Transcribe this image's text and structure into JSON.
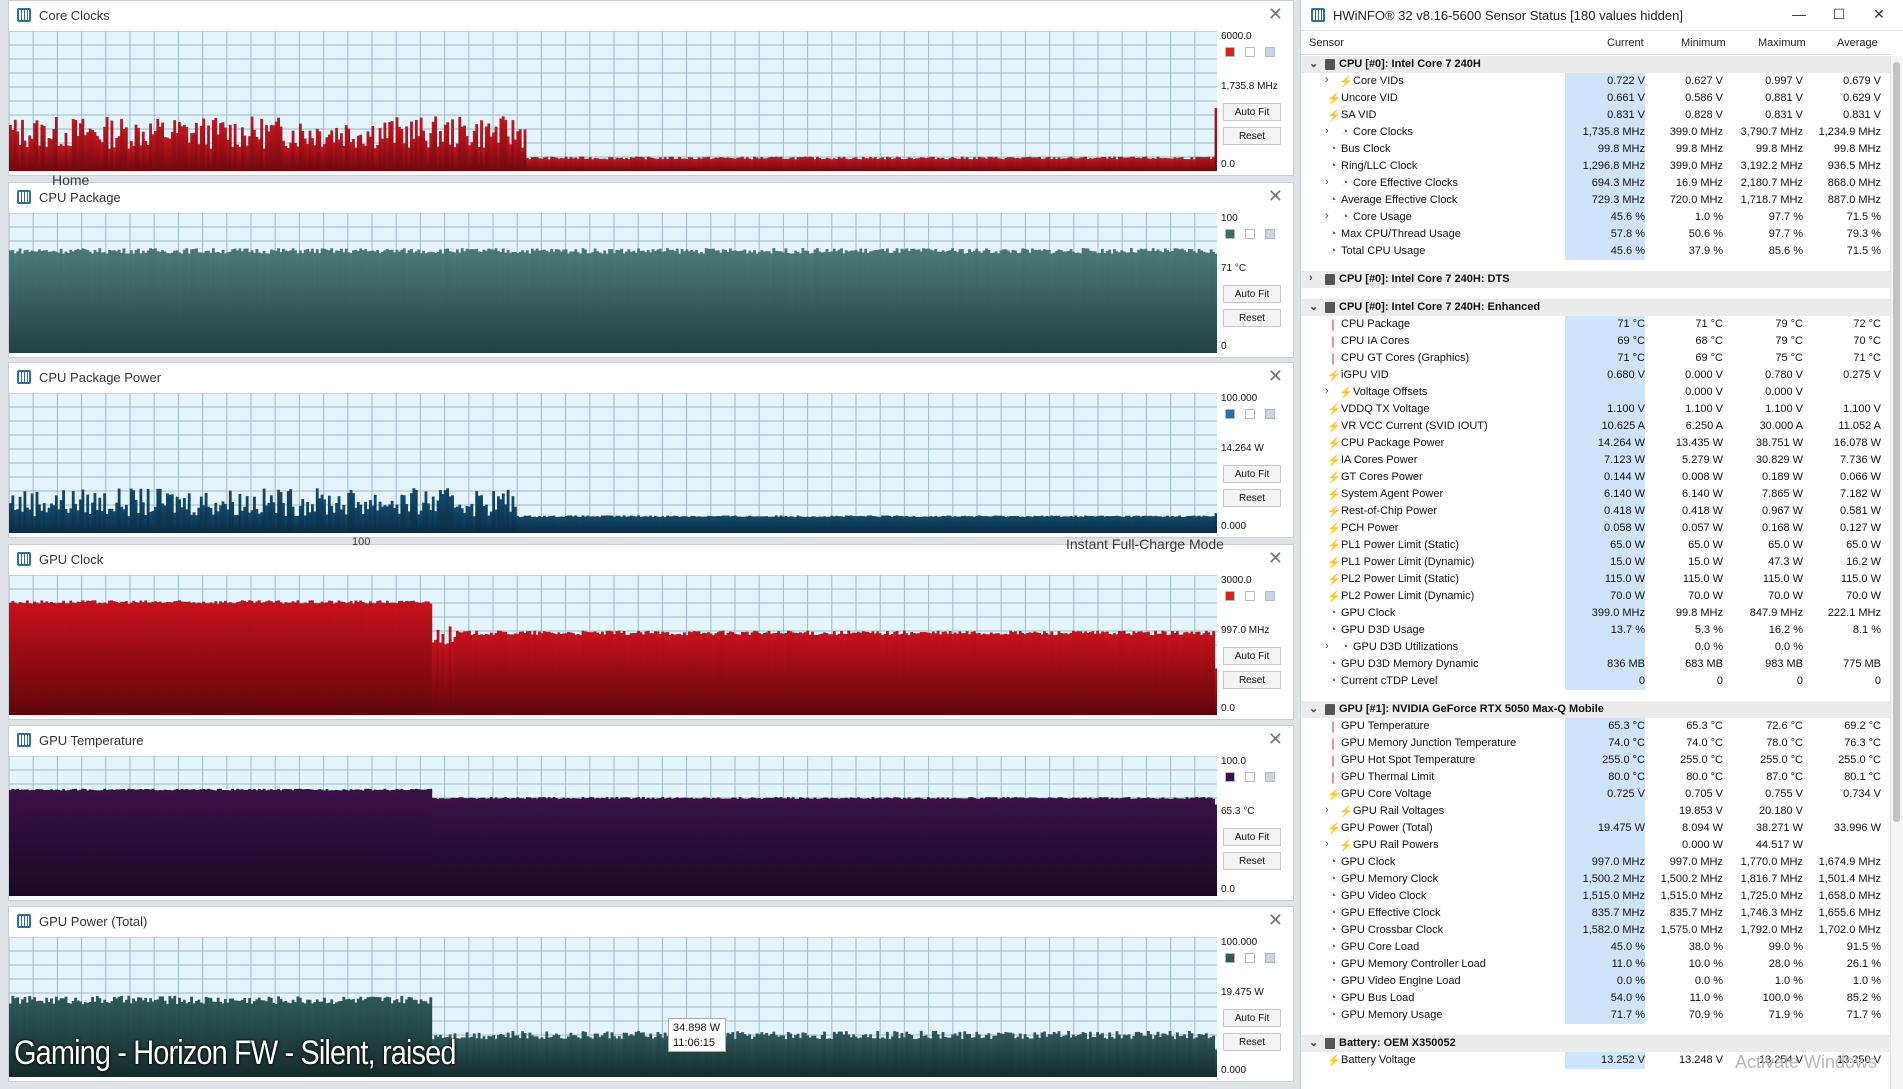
{
  "graphs": [
    {
      "id": "core-clocks",
      "title": "Core Clocks",
      "max": "6000.0",
      "cur": "1,735.8 MHz",
      "min": "0.0",
      "color": "#c3161c",
      "dark": "#6c0a10",
      "sq": [
        "#e01d1d",
        "#ffffff",
        "#c9d6ea"
      ],
      "chart_data": {
        "type": "bar",
        "ylim": [
          0,
          6000
        ],
        "phases": [
          {
            "n": 214,
            "base": 1650,
            "amp": 700
          },
          {
            "n": 286,
            "base": 560,
            "amp": 60
          }
        ],
        "spike_end": 2700
      }
    },
    {
      "id": "cpu-package",
      "title": "CPU Package",
      "max": "100",
      "cur": "71 °C",
      "min": "0",
      "color": "#4a7a76",
      "dark": "#23413f",
      "sq": [
        "#3a6b66",
        "#ffffff",
        "#c9d6ea"
      ],
      "chart_data": {
        "type": "bar",
        "ylim": [
          0,
          100
        ],
        "phases": [
          {
            "n": 500,
            "base": 73,
            "amp": 2
          }
        ],
        "spike_end": 71
      }
    },
    {
      "id": "cpu-package-power",
      "title": "CPU Package Power",
      "max": "100.000",
      "cur": "14.264 W",
      "min": "0.000",
      "color": "#124a6d",
      "dark": "#0a2c42",
      "sq": [
        "#1f6fb8",
        "#ffffff",
        "#c9d6ea"
      ],
      "chart_data": {
        "type": "bar",
        "ylim": [
          0,
          100
        ],
        "phases": [
          {
            "n": 210,
            "base": 22,
            "amp": 10
          },
          {
            "n": 290,
            "base": 12,
            "amp": 0.6
          }
        ],
        "spike_end": 14.2
      }
    },
    {
      "id": "gpu-clock",
      "title": "GPU Clock",
      "max": "3000.0",
      "cur": "997.0 MHz",
      "min": "0.0",
      "color": "#c8111a",
      "dark": "#5e070c",
      "sq": [
        "#e01d1d",
        "#ffffff",
        "#c9d6ea"
      ],
      "chart_data": {
        "type": "bar",
        "ylim": [
          0,
          3000
        ],
        "phases": [
          {
            "n": 175,
            "base": 2420,
            "amp": 40
          },
          {
            "n": 10,
            "base": 1700,
            "amp": 200
          },
          {
            "n": 315,
            "base": 1760,
            "amp": 50
          }
        ],
        "spike_end": 997
      }
    },
    {
      "id": "gpu-temperature",
      "title": "GPU Temperature",
      "max": "100.0",
      "cur": "65.3 °C",
      "min": "0.0",
      "color": "#3a1149",
      "dark": "#1a0822",
      "sq": [
        "#3a1149",
        "#ffffff",
        "#c9d6ea"
      ],
      "chart_data": {
        "type": "bar",
        "ylim": [
          0,
          100
        ],
        "phases": [
          {
            "n": 175,
            "base": 76,
            "amp": 0.6
          },
          {
            "n": 325,
            "base": 70,
            "amp": 0.7
          }
        ],
        "spike_end": 65.3
      }
    },
    {
      "id": "gpu-power-total",
      "title": "GPU Power (Total)",
      "max": "100.000",
      "cur": "19.475 W",
      "min": "0.000",
      "color": "#2d5a58",
      "dark": "#142b2a",
      "sq": [
        "#2d5a58",
        "#ffffff",
        "#c9d6ea"
      ],
      "chart_data": {
        "type": "bar",
        "ylim": [
          0,
          100
        ],
        "phases": [
          {
            "n": 175,
            "base": 55,
            "amp": 3
          },
          {
            "n": 325,
            "base": 30,
            "amp": 3
          }
        ],
        "spike_end": 19.5
      }
    }
  ],
  "buttons": {
    "autofit": "Auto Fit",
    "reset": "Reset"
  },
  "overlay": "Gaming - Horizon FW - Silent, raised",
  "tooltip": {
    "value": "34.898 W",
    "time": "11:06:15"
  },
  "ghosts": {
    "home": "Home",
    "hundred": "100",
    "instant": "Instant Full-Charge Mode"
  },
  "hwinfo": {
    "title": "HWiNFO® 32 v8.16-5600 Sensor Status [180 values hidden]",
    "columns": {
      "sensor": "Sensor",
      "current": "Current",
      "minimum": "Minimum",
      "maximum": "Maximum",
      "average": "Average"
    },
    "watermark": "Activate Windows",
    "rows": [
      {
        "t": "sec",
        "name": "CPU [#0]: Intel Core 7 240H",
        "open": true
      },
      {
        "name": "Core VIDs",
        "i": "v",
        "sub": true,
        "c": "0.722 V",
        "mn": "0.627 V",
        "mx": "0.997 V",
        "av": "0.679 V"
      },
      {
        "name": "Uncore VID",
        "i": "v",
        "c": "0.661 V",
        "mn": "0.586 V",
        "mx": "0.881 V",
        "av": "0.629 V"
      },
      {
        "name": "SA VID",
        "i": "v",
        "c": "0.831 V",
        "mn": "0.828 V",
        "mx": "0.831 V",
        "av": "0.831 V"
      },
      {
        "name": "Core Clocks",
        "i": "c",
        "sub": true,
        "c": "1,735.8 MHz",
        "mn": "399.0 MHz",
        "mx": "3,790.7 MHz",
        "av": "1,234.9 MHz"
      },
      {
        "name": "Bus Clock",
        "i": "c",
        "c": "99.8 MHz",
        "mn": "99.8 MHz",
        "mx": "99.8 MHz",
        "av": "99.8 MHz"
      },
      {
        "name": "Ring/LLC Clock",
        "i": "c",
        "c": "1,296.8 MHz",
        "mn": "399.0 MHz",
        "mx": "3,192.2 MHz",
        "av": "936.5 MHz"
      },
      {
        "name": "Core Effective Clocks",
        "i": "c",
        "sub": true,
        "c": "694.3 MHz",
        "mn": "16.9 MHz",
        "mx": "2,180.7 MHz",
        "av": "868.0 MHz"
      },
      {
        "name": "Average Effective Clock",
        "i": "c",
        "c": "729.3 MHz",
        "mn": "720.0 MHz",
        "mx": "1,718.7 MHz",
        "av": "887.0 MHz"
      },
      {
        "name": "Core Usage",
        "i": "c",
        "sub": true,
        "c": "45.6 %",
        "mn": "1.0 %",
        "mx": "97.7 %",
        "av": "71.5 %"
      },
      {
        "name": "Max CPU/Thread Usage",
        "i": "c",
        "c": "57.8 %",
        "mn": "50.6 %",
        "mx": "97.7 %",
        "av": "79.3 %"
      },
      {
        "name": "Total CPU Usage",
        "i": "c",
        "c": "45.6 %",
        "mn": "37.9 %",
        "mx": "85.6 %",
        "av": "71.5 %"
      },
      {
        "t": "gap"
      },
      {
        "t": "sec",
        "name": "CPU [#0]: Intel Core 7 240H: DTS",
        "open": false
      },
      {
        "t": "gap"
      },
      {
        "t": "sec",
        "name": "CPU [#0]: Intel Core 7 240H: Enhanced",
        "open": true
      },
      {
        "name": "CPU Package",
        "i": "t",
        "c": "71 °C",
        "mn": "71 °C",
        "mx": "79 °C",
        "av": "72 °C"
      },
      {
        "name": "CPU IA Cores",
        "i": "t",
        "c": "69 °C",
        "mn": "68 °C",
        "mx": "79 °C",
        "av": "70 °C"
      },
      {
        "name": "CPU GT Cores (Graphics)",
        "i": "t",
        "c": "71 °C",
        "mn": "69 °C",
        "mx": "75 °C",
        "av": "71 °C"
      },
      {
        "name": "iGPU VID",
        "i": "v",
        "c": "0.680 V",
        "mn": "0.000 V",
        "mx": "0.780 V",
        "av": "0.275 V"
      },
      {
        "name": "Voltage Offsets",
        "i": "v",
        "sub": true,
        "c": "",
        "mn": "0.000 V",
        "mx": "0.000 V",
        "av": ""
      },
      {
        "name": "VDDQ TX Voltage",
        "i": "v",
        "c": "1.100 V",
        "mn": "1.100 V",
        "mx": "1.100 V",
        "av": "1.100 V"
      },
      {
        "name": "VR VCC Current (SVID IOUT)",
        "i": "v",
        "c": "10.625 A",
        "mn": "6.250 A",
        "mx": "30.000 A",
        "av": "11.052 A"
      },
      {
        "name": "CPU Package Power",
        "i": "v",
        "c": "14.264 W",
        "mn": "13.435 W",
        "mx": "38.751 W",
        "av": "16.078 W"
      },
      {
        "name": "IA Cores Power",
        "i": "v",
        "c": "7.123 W",
        "mn": "5.279 W",
        "mx": "30.829 W",
        "av": "7.736 W"
      },
      {
        "name": "GT Cores Power",
        "i": "v",
        "c": "0.144 W",
        "mn": "0.008 W",
        "mx": "0.189 W",
        "av": "0.066 W"
      },
      {
        "name": "System Agent Power",
        "i": "v",
        "c": "6.140 W",
        "mn": "6.140 W",
        "mx": "7.865 W",
        "av": "7.182 W"
      },
      {
        "name": "Rest-of-Chip Power",
        "i": "v",
        "c": "0.418 W",
        "mn": "0.418 W",
        "mx": "0.967 W",
        "av": "0.581 W"
      },
      {
        "name": "PCH Power",
        "i": "v",
        "c": "0.058 W",
        "mn": "0.057 W",
        "mx": "0.168 W",
        "av": "0.127 W"
      },
      {
        "name": "PL1 Power Limit (Static)",
        "i": "v",
        "c": "65.0 W",
        "mn": "65.0 W",
        "mx": "65.0 W",
        "av": "65.0 W"
      },
      {
        "name": "PL1 Power Limit (Dynamic)",
        "i": "v",
        "c": "15.0 W",
        "mn": "15.0 W",
        "mx": "47.3 W",
        "av": "16.2 W"
      },
      {
        "name": "PL2 Power Limit (Static)",
        "i": "v",
        "c": "115.0 W",
        "mn": "115.0 W",
        "mx": "115.0 W",
        "av": "115.0 W"
      },
      {
        "name": "PL2 Power Limit (Dynamic)",
        "i": "v",
        "c": "70.0 W",
        "mn": "70.0 W",
        "mx": "70.0 W",
        "av": "70.0 W"
      },
      {
        "name": "GPU Clock",
        "i": "c",
        "c": "399.0 MHz",
        "mn": "99.8 MHz",
        "mx": "847.9 MHz",
        "av": "222.1 MHz"
      },
      {
        "name": "GPU D3D Usage",
        "i": "c",
        "c": "13.7 %",
        "mn": "5.3 %",
        "mx": "16.2 %",
        "av": "8.1 %"
      },
      {
        "name": "GPU D3D Utilizations",
        "i": "c",
        "sub": true,
        "c": "",
        "mn": "0.0 %",
        "mx": "0.0 %",
        "av": ""
      },
      {
        "name": "GPU D3D Memory Dynamic",
        "i": "c",
        "c": "836 MB",
        "mn": "683 MB",
        "mx": "983 MB",
        "av": "775 MB"
      },
      {
        "name": "Current cTDP Level",
        "i": "c",
        "c": "0",
        "mn": "0",
        "mx": "0",
        "av": "0"
      },
      {
        "t": "gap"
      },
      {
        "t": "sec",
        "name": "GPU [#1]: NVIDIA  GeForce RTX 5050 Max-Q Mobile",
        "open": true
      },
      {
        "name": "GPU Temperature",
        "i": "t",
        "c": "65.3 °C",
        "mn": "65.3 °C",
        "mx": "72.6 °C",
        "av": "69.2 °C"
      },
      {
        "name": "GPU Memory Junction Temperature",
        "i": "t",
        "c": "74.0 °C",
        "mn": "74.0 °C",
        "mx": "78.0 °C",
        "av": "76.3 °C"
      },
      {
        "name": "GPU Hot Spot Temperature",
        "i": "t",
        "c": "255.0 °C",
        "mn": "255.0 °C",
        "mx": "255.0 °C",
        "av": "255.0 °C"
      },
      {
        "name": "GPU Thermal Limit",
        "i": "t",
        "c": "80.0 °C",
        "mn": "80.0 °C",
        "mx": "87.0 °C",
        "av": "80.1 °C"
      },
      {
        "name": "GPU Core Voltage",
        "i": "v",
        "c": "0.725 V",
        "mn": "0.705 V",
        "mx": "0.755 V",
        "av": "0.734 V"
      },
      {
        "name": "GPU Rail Voltages",
        "i": "v",
        "sub": true,
        "c": "",
        "mn": "19.853 V",
        "mx": "20.180 V",
        "av": ""
      },
      {
        "name": "GPU Power (Total)",
        "i": "v",
        "c": "19.475 W",
        "mn": "8.094 W",
        "mx": "38.271 W",
        "av": "33.996 W"
      },
      {
        "name": "GPU Rail Powers",
        "i": "v",
        "sub": true,
        "c": "",
        "mn": "0.000 W",
        "mx": "44.517 W",
        "av": ""
      },
      {
        "name": "GPU Clock",
        "i": "c",
        "c": "997.0 MHz",
        "mn": "997.0 MHz",
        "mx": "1,770.0 MHz",
        "av": "1,674.9 MHz"
      },
      {
        "name": "GPU Memory Clock",
        "i": "c",
        "c": "1,500.2 MHz",
        "mn": "1,500.2 MHz",
        "mx": "1,816.7 MHz",
        "av": "1,501.4 MHz"
      },
      {
        "name": "GPU Video Clock",
        "i": "c",
        "c": "1,515.0 MHz",
        "mn": "1,515.0 MHz",
        "mx": "1,725.0 MHz",
        "av": "1,658.0 MHz"
      },
      {
        "name": "GPU Effective Clock",
        "i": "c",
        "c": "835.7 MHz",
        "mn": "835.7 MHz",
        "mx": "1,746.3 MHz",
        "av": "1,655.6 MHz"
      },
      {
        "name": "GPU Crossbar Clock",
        "i": "c",
        "c": "1,582.0 MHz",
        "mn": "1,575.0 MHz",
        "mx": "1,792.0 MHz",
        "av": "1,702.0 MHz"
      },
      {
        "name": "GPU Core Load",
        "i": "c",
        "c": "45.0 %",
        "mn": "38.0 %",
        "mx": "99.0 %",
        "av": "91.5 %"
      },
      {
        "name": "GPU Memory Controller Load",
        "i": "c",
        "c": "11.0 %",
        "mn": "10.0 %",
        "mx": "28.0 %",
        "av": "26.1 %"
      },
      {
        "name": "GPU Video Engine Load",
        "i": "c",
        "c": "0.0 %",
        "mn": "0.0 %",
        "mx": "1.0 %",
        "av": "1.0 %"
      },
      {
        "name": "GPU Bus Load",
        "i": "c",
        "c": "54.0 %",
        "mn": "11.0 %",
        "mx": "100.0 %",
        "av": "85.2 %"
      },
      {
        "name": "GPU Memory Usage",
        "i": "c",
        "c": "71.7 %",
        "mn": "70.9 %",
        "mx": "71.9 %",
        "av": "71.7 %"
      },
      {
        "t": "gap"
      },
      {
        "t": "sec",
        "name": "Battery: OEM X350052",
        "open": true
      },
      {
        "name": "Battery Voltage",
        "i": "v",
        "c": "13.252 V",
        "mn": "13.248 V",
        "mx": "13.254 V",
        "av": "13.250 V"
      }
    ]
  }
}
